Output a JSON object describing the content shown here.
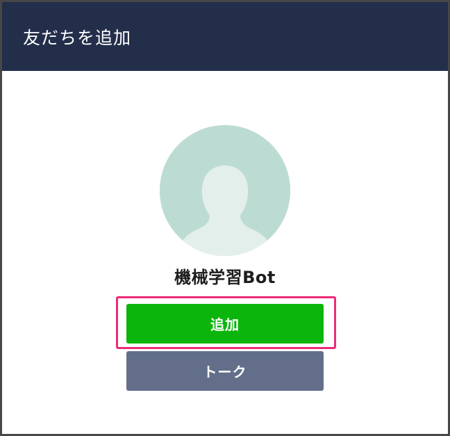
{
  "header": {
    "title": "友だちを追加"
  },
  "profile": {
    "avatar_icon": "default-user-avatar-icon",
    "name": "機械学習Bot"
  },
  "actions": {
    "add_label": "追加",
    "talk_label": "トーク"
  },
  "colors": {
    "header_bg": "#232e4b",
    "add_button": "#0bb50b",
    "talk_button": "#636f8a",
    "highlight_border": "#ec2a78",
    "avatar_bg": "#bcdcd3",
    "avatar_silhouette": "#e3efeb"
  }
}
